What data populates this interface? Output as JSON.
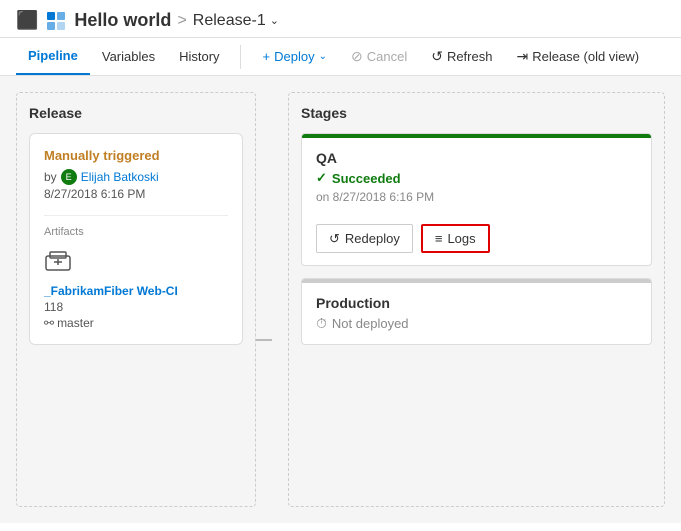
{
  "header": {
    "icon": "⊞",
    "title": "Hello world",
    "separator": ">",
    "subtitle": "Release-1",
    "dropdown_arrow": "∨"
  },
  "navbar": {
    "tabs": [
      {
        "id": "pipeline",
        "label": "Pipeline",
        "active": true
      },
      {
        "id": "variables",
        "label": "Variables",
        "active": false
      },
      {
        "id": "history",
        "label": "History",
        "active": false
      }
    ],
    "actions": [
      {
        "id": "deploy",
        "label": "Deploy",
        "icon": "+",
        "primary": true,
        "has_dropdown": true
      },
      {
        "id": "cancel",
        "label": "Cancel",
        "icon": "⊘",
        "disabled": true
      },
      {
        "id": "refresh",
        "label": "Refresh",
        "icon": "↺"
      },
      {
        "id": "release-old",
        "label": "Release (old view)",
        "icon": "→"
      }
    ]
  },
  "release_section": {
    "title": "Release",
    "card": {
      "trigger": "Manually triggered",
      "by_label": "by",
      "avatar_initials": "E",
      "user_name": "Elijah Batkoski",
      "date": "8/27/2018 6:16 PM",
      "artifacts_label": "Artifacts",
      "artifact_name": "_FabrikamFiber Web-CI",
      "artifact_build": "118",
      "artifact_branch": "master"
    }
  },
  "stages_section": {
    "title": "Stages",
    "stages": [
      {
        "id": "qa",
        "name": "QA",
        "status": "Succeeded",
        "status_type": "success",
        "date": "on 8/27/2018 6:16 PM",
        "actions": [
          {
            "id": "redeploy",
            "label": "Redeploy",
            "icon": "↺",
            "highlight": false
          },
          {
            "id": "logs",
            "label": "Logs",
            "icon": "≡",
            "highlight": true
          }
        ]
      },
      {
        "id": "production",
        "name": "Production",
        "status": "Not deployed",
        "status_type": "not-deployed",
        "date": "",
        "actions": []
      }
    ]
  }
}
